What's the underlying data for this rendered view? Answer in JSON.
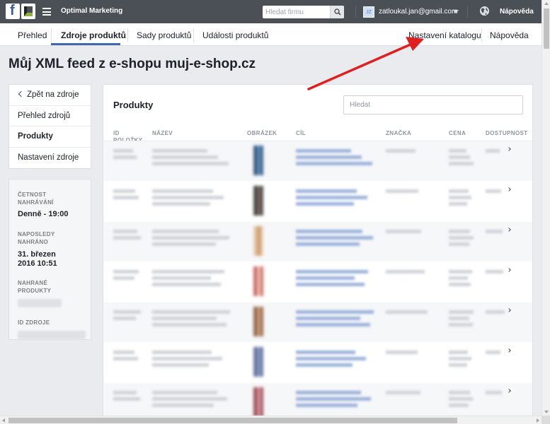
{
  "topbar": {
    "app_title": "Optimal Marketing",
    "search_placeholder": "Hledat firmu",
    "avatar_initials": "JZ",
    "user_email": "zatloukal.jan@gmail.com",
    "help": "Nápověda"
  },
  "subnav": {
    "tabs": [
      "Přehled",
      "Zdroje produktů",
      "Sady produktů",
      "Události produktů"
    ],
    "active_tab": "Zdroje produktů",
    "right_links": [
      "Nastavení katalogu",
      "Nápověda"
    ]
  },
  "page_title": "Můj XML feed z e-shopu muj-e-shop.cz",
  "leftnav": {
    "back": "Zpět na zdroje",
    "items": [
      "Přehled zdrojů",
      "Produkty",
      "Nastavení zdroje"
    ],
    "active": "Produkty"
  },
  "info": {
    "frequency_label": "ČETNOST NAHRÁVÁNÍ",
    "frequency_value": "Denně - 19:00",
    "last_upload_label": "NAPOSLEDY NAHRÁNO",
    "last_upload_value": "31. březen 2016 10:51",
    "uploaded_products_label": "NAHRANÉ PRODUKTY",
    "source_id_label": "ID ZDROJE"
  },
  "products": {
    "title": "Produkty",
    "search_placeholder": "Hledat",
    "columns": [
      "ID POLOŽKY",
      "NÁZEV",
      "OBRÁZEK",
      "CÍL",
      "ZNAČKA",
      "CENA",
      "DOSTUPNOST"
    ],
    "row_count": 7,
    "thumb_colors": [
      [
        "#1f3a6b",
        "#6aa4c8"
      ],
      [
        "#2a2a2a",
        "#8a7a6a"
      ],
      [
        "#e8c8a0",
        "#c89870"
      ],
      [
        "#c04040",
        "#f0e0d0"
      ],
      [
        "#7a4a2a",
        "#d8b090"
      ],
      [
        "#4a5a8a",
        "#9aa8c8"
      ],
      [
        "#8a2a3a",
        "#e0b0b0"
      ]
    ]
  },
  "colors": {
    "topbar": "#4b4f56",
    "accent": "#4267b2",
    "annotation_arrow": "#e02020"
  }
}
